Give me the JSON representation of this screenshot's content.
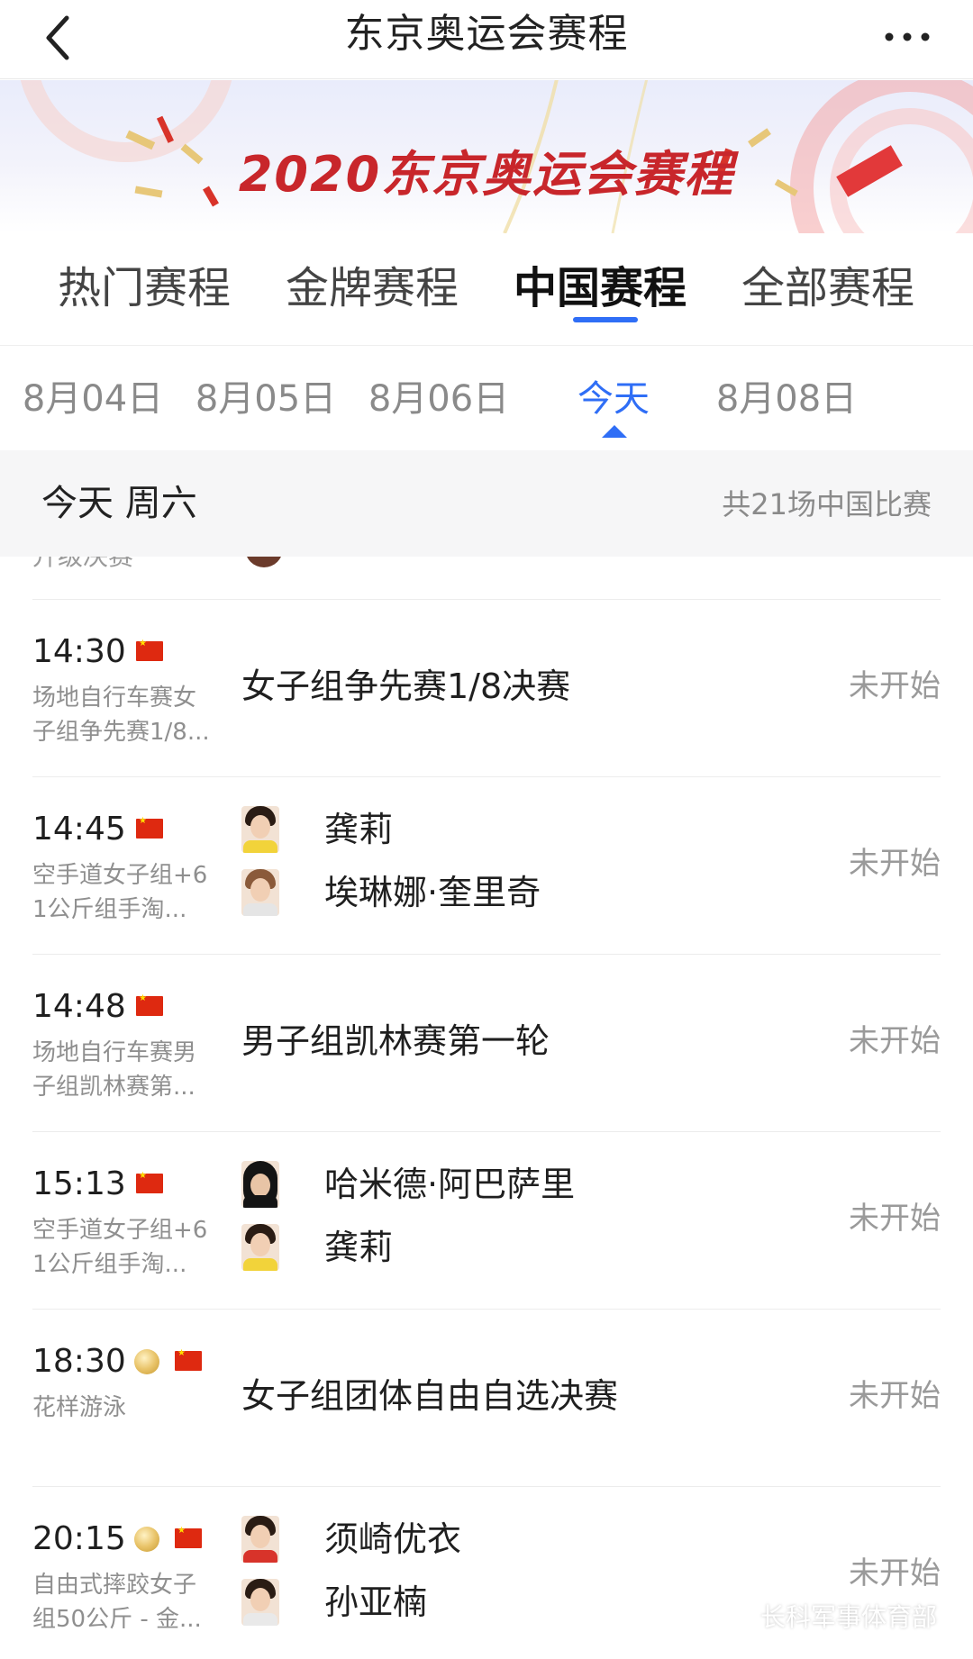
{
  "nav": {
    "title": "东京奥运会赛程",
    "back_icon": "chevron-left-icon",
    "more_icon": "more-dots-icon"
  },
  "banner": {
    "title": "2020东京奥运会赛程"
  },
  "tabs": [
    {
      "label": "热门赛程",
      "active": false
    },
    {
      "label": "金牌赛程",
      "active": false
    },
    {
      "label": "中国赛程",
      "active": true
    },
    {
      "label": "全部赛程",
      "active": false
    }
  ],
  "dates": [
    {
      "label": "8月04日",
      "active": false
    },
    {
      "label": "8月05日",
      "active": false
    },
    {
      "label": "8月06日",
      "active": false
    },
    {
      "label": "今天",
      "active": true
    },
    {
      "label": "8月08日",
      "active": false
    }
  ],
  "day_header": {
    "label": "今天 周六",
    "count": "共21场中国比赛"
  },
  "partial_row": {
    "sport": "升级决赛"
  },
  "rows": [
    {
      "time": "14:30",
      "medal": false,
      "sport_line1": "场地自行车赛女",
      "sport_line2": "子组争先赛1/8...",
      "event": "女子组争先赛1/8决赛",
      "players": [],
      "status": "未开始"
    },
    {
      "time": "14:45",
      "medal": false,
      "sport_line1": "空手道女子组+6",
      "sport_line2": "1公斤组手淘...",
      "event": "",
      "players": [
        {
          "name": "龚莉"
        },
        {
          "name": "埃琳娜·奎里奇"
        }
      ],
      "status": "未开始"
    },
    {
      "time": "14:48",
      "medal": false,
      "sport_line1": "场地自行车赛男",
      "sport_line2": "子组凯林赛第...",
      "event": "男子组凯林赛第一轮",
      "players": [],
      "status": "未开始"
    },
    {
      "time": "15:13",
      "medal": false,
      "sport_line1": "空手道女子组+6",
      "sport_line2": "1公斤组手淘...",
      "event": "",
      "players": [
        {
          "name": "哈米德·阿巴萨里"
        },
        {
          "name": "龚莉"
        }
      ],
      "status": "未开始"
    },
    {
      "time": "18:30",
      "medal": true,
      "sport_line1": "花样游泳",
      "sport_line2": "",
      "event": "女子组团体自由自选决赛",
      "players": [],
      "status": "未开始"
    },
    {
      "time": "20:15",
      "medal": true,
      "sport_line1": "自由式摔跤女子",
      "sport_line2": "组50公斤 - 金...",
      "event": "",
      "players": [
        {
          "name": "须崎优衣"
        },
        {
          "name": "孙亚楠"
        }
      ],
      "status": "未开始"
    }
  ],
  "watermark": {
    "text": "长科军事体育部"
  },
  "colors": {
    "accent": "#2f6ef6",
    "banner_title": "#c8262b",
    "flag": "#de2910"
  }
}
